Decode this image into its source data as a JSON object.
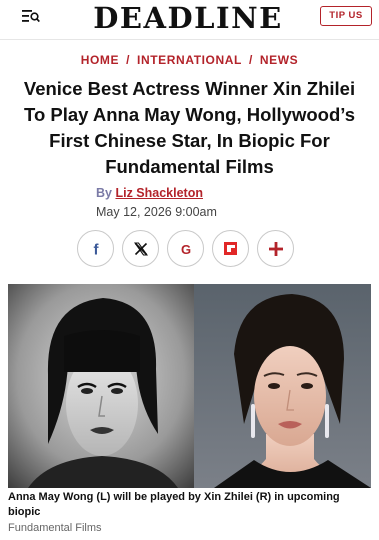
{
  "header": {
    "logo": "DEADLINE",
    "tip_button": "TIP US",
    "menu_icon": "menu-search-icon"
  },
  "breadcrumb": {
    "items": [
      "HOME",
      "INTERNATIONAL",
      "NEWS"
    ],
    "separator": "/"
  },
  "article": {
    "headline": "Venice Best Actress Winner Xin Zhilei To Play Anna May Wong, Hollywood’s First Chinese Star, In Biopic For Fundamental Films",
    "byline_prefix": "By",
    "author": "Liz Shackleton",
    "date": "May 12, 2026 9:00am"
  },
  "share": [
    {
      "name": "facebook",
      "icon": "facebook-icon",
      "color": "#3b5998"
    },
    {
      "name": "x",
      "icon": "x-icon",
      "color": "#111111"
    },
    {
      "name": "google",
      "icon": "google-icon",
      "color": "#b3232a"
    },
    {
      "name": "flipboard",
      "icon": "flipboard-icon",
      "color": "#e12828"
    },
    {
      "name": "more",
      "icon": "plus-icon",
      "color": "#b3232a"
    }
  ],
  "image": {
    "caption": "Anna May Wong (L) will be played by Xin Zhilei (R) in upcoming biopic",
    "credit": "Fundamental Films"
  },
  "colors": {
    "accent": "#b3232a",
    "byline": "#7a7aa6"
  }
}
